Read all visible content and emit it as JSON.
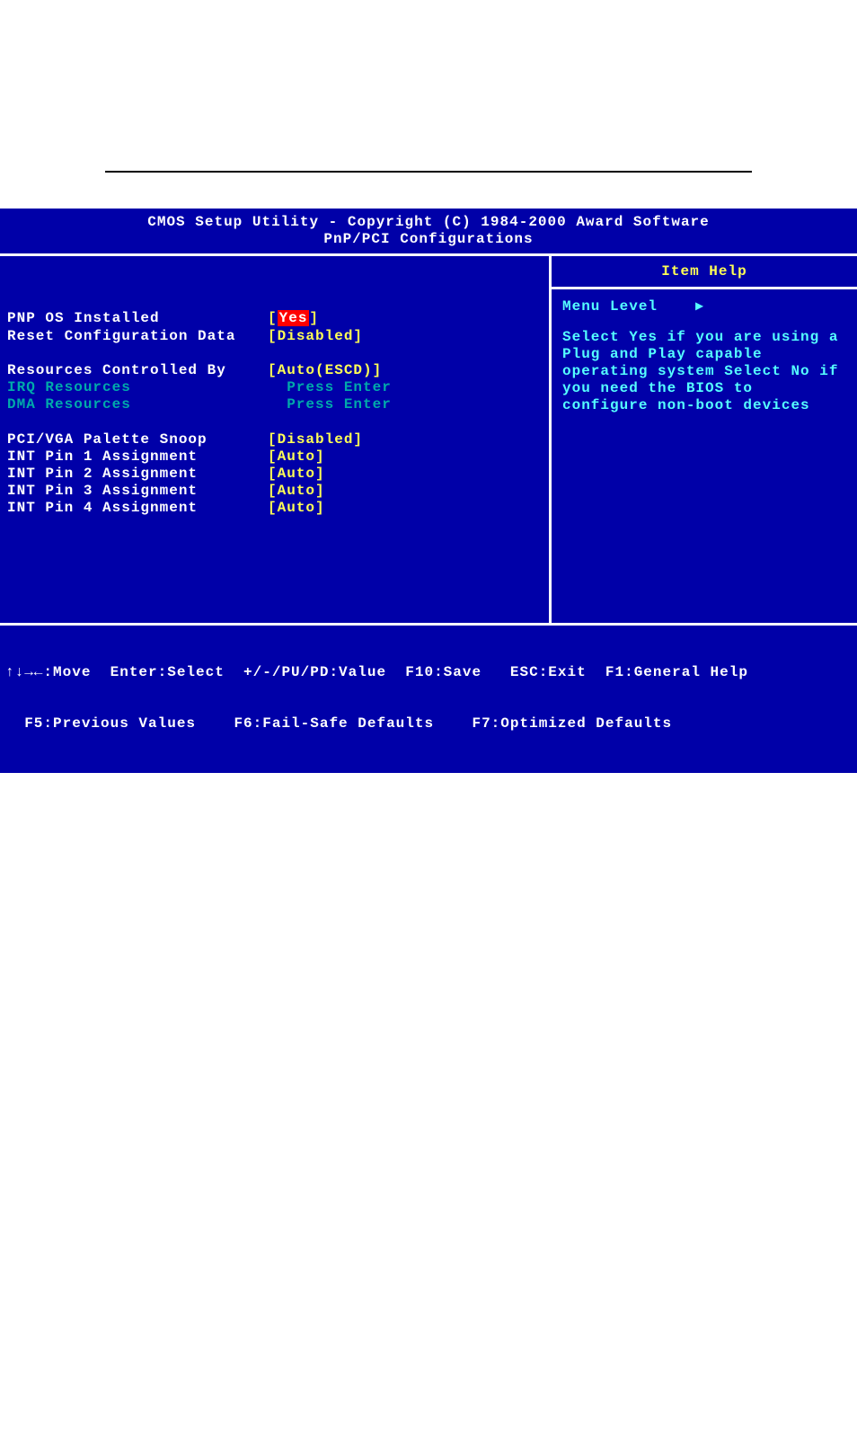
{
  "header": {
    "line1": "CMOS Setup Utility - Copyright (C) 1984-2000 Award Software",
    "line2": "PnP/PCI Configurations"
  },
  "items": [
    {
      "label": "PNP OS Installed",
      "value": "Yes",
      "valueClass": "highlighted",
      "brackets": true,
      "labelClass": ""
    },
    {
      "label": "Reset Configuration Data",
      "value": "Disabled",
      "valueClass": "value",
      "brackets": true,
      "labelClass": ""
    },
    {
      "blank": true
    },
    {
      "label": "Resources Controlled By",
      "value": "Auto(ESCD)",
      "valueClass": "value",
      "brackets": true,
      "labelClass": ""
    },
    {
      "label": "IRQ Resources",
      "value": "  Press Enter",
      "valueClass": "dim-value",
      "brackets": false,
      "labelClass": "dim-label"
    },
    {
      "label": "DMA Resources",
      "value": "  Press Enter",
      "valueClass": "dim-value",
      "brackets": false,
      "labelClass": "dim-label"
    },
    {
      "blank": true
    },
    {
      "label": "PCI/VGA Palette Snoop",
      "value": "Disabled",
      "valueClass": "value",
      "brackets": true,
      "labelClass": ""
    },
    {
      "label": "INT Pin 1 Assignment",
      "value": "Auto",
      "valueClass": "value",
      "brackets": true,
      "labelClass": ""
    },
    {
      "label": "INT Pin 2 Assignment",
      "value": "Auto",
      "valueClass": "value",
      "brackets": true,
      "labelClass": ""
    },
    {
      "label": "INT Pin 3 Assignment",
      "value": "Auto",
      "valueClass": "value",
      "brackets": true,
      "labelClass": ""
    },
    {
      "label": "INT Pin 4 Assignment",
      "value": "Auto",
      "valueClass": "value",
      "brackets": true,
      "labelClass": ""
    }
  ],
  "help": {
    "title": "Item Help",
    "menuLevel": "Menu Level",
    "arrow": "▸",
    "text": "Select Yes if you are using a Plug and Play capable operating system Select No if you need the BIOS to configure non-boot devices"
  },
  "footer": {
    "line1": "↑↓→←:Move  Enter:Select  +/-/PU/PD:Value  F10:Save   ESC:Exit  F1:General Help",
    "line2": "  F5:Previous Values    F6:Fail-Safe Defaults    F7:Optimized Defaults"
  }
}
